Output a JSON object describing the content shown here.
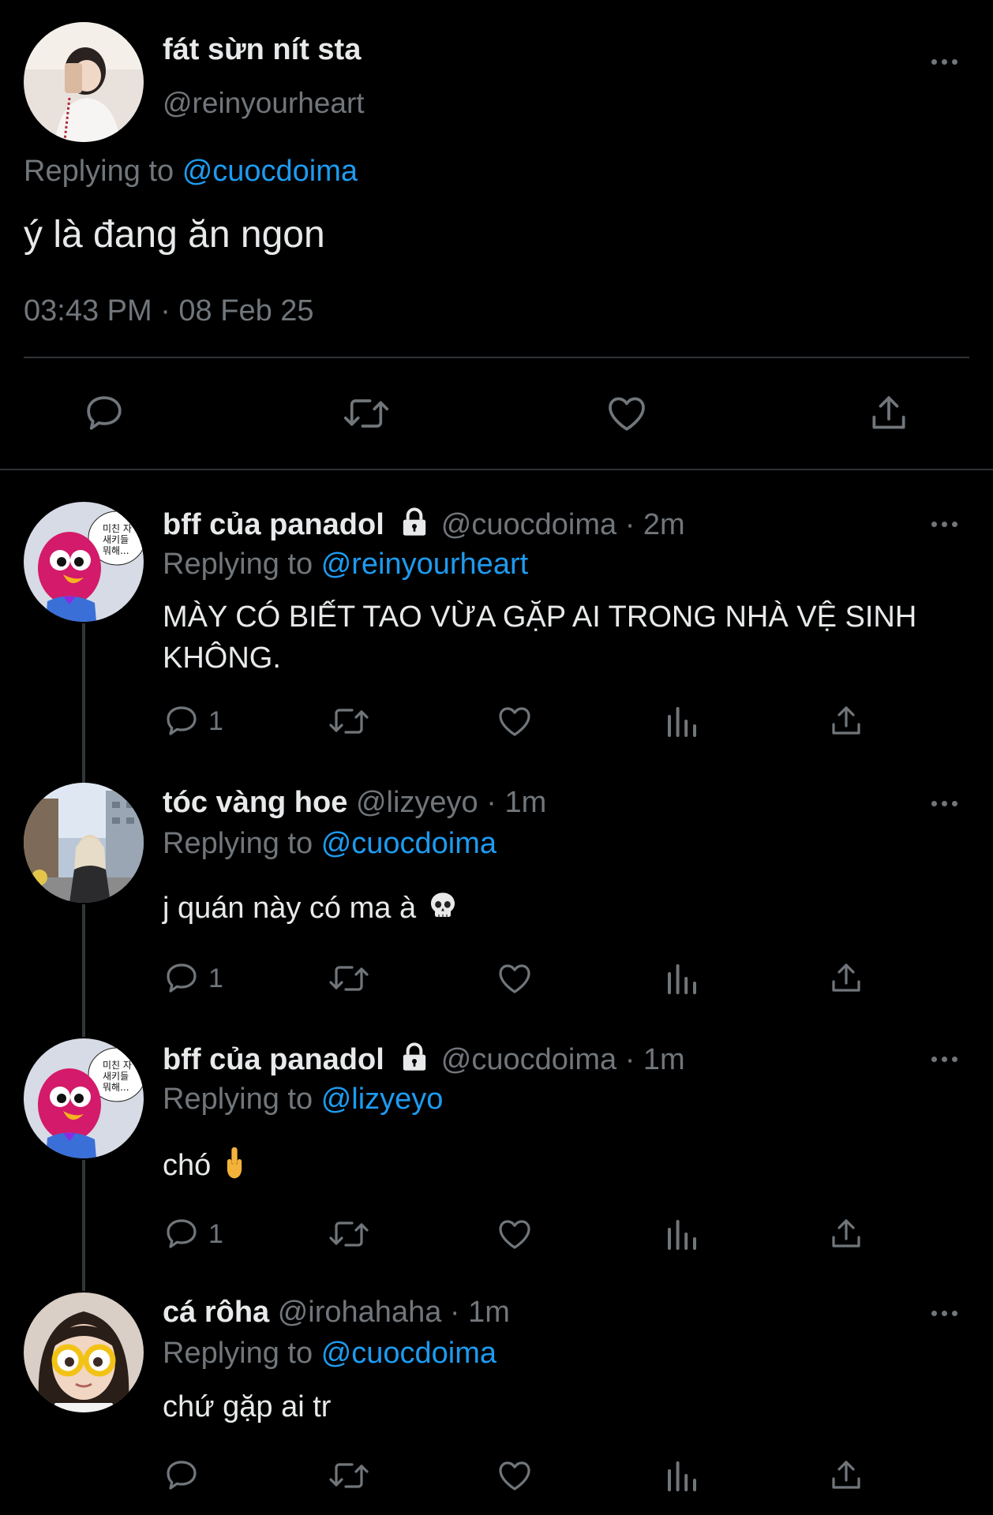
{
  "main_tweet": {
    "display_name": "fát sừn nít sta",
    "handle": "@reinyourheart",
    "replying_prefix": "Replying to",
    "replying_to": "@cuocdoima",
    "text": "ý là đang ăn ngon",
    "timestamp": "03:43 PM · 08 Feb 25",
    "icons": [
      "reply-icon",
      "retweet-icon",
      "like-icon",
      "share-icon"
    ]
  },
  "replies": [
    {
      "display_name": "bff của panadol",
      "handle": "@cuocdoima",
      "time": "· 2m",
      "locked": true,
      "replying_prefix": "Replying to",
      "replying_to": "@reinyourheart",
      "text": "MÀY CÓ BIẾT TAO VỪA GẶP AI TRONG NHÀ VỆ SINH KHÔNG.",
      "reply_count": "1",
      "avatar_text": "미친 자\n새키들\n뭐해..."
    },
    {
      "display_name": "tóc vàng hoe",
      "handle": "@lizyeyo",
      "time": "· 1m",
      "locked": false,
      "replying_prefix": "Replying to",
      "replying_to": "@cuocdoima",
      "text": "j quán này có ma à",
      "emoji": "skull",
      "reply_count": "1"
    },
    {
      "display_name": "bff của panadol",
      "handle": "@cuocdoima",
      "time": "· 1m",
      "locked": true,
      "replying_prefix": "Replying to",
      "replying_to": "@lizyeyo",
      "text": "chó",
      "emoji": "middle-finger",
      "reply_count": "1",
      "avatar_text": "미친 자\n새키들\n뭐해..."
    },
    {
      "display_name": "cá rôha",
      "handle": "@irohahaha",
      "time": "· 1m",
      "locked": false,
      "replying_prefix": "Replying to",
      "replying_to": "@cuocdoima",
      "text": "chứ gặp ai tr",
      "reply_count": ""
    }
  ],
  "colors": {
    "background": "#000000",
    "text": "#e7e9ea",
    "muted": "#71767b",
    "link": "#1d9bf0",
    "divider": "#2f3336"
  }
}
